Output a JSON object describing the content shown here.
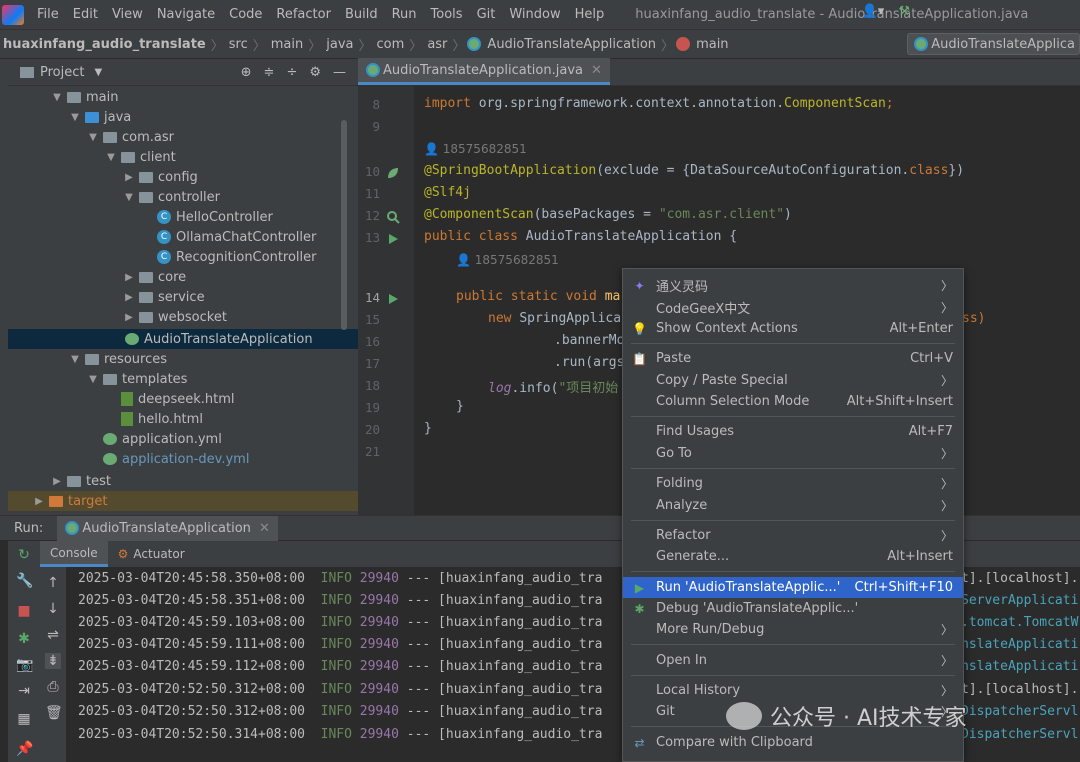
{
  "window": {
    "title": "huaxinfang_audio_translate - AudioTranslateApplication.java"
  },
  "menu": [
    "File",
    "Edit",
    "View",
    "Navigate",
    "Code",
    "Refactor",
    "Build",
    "Run",
    "Tools",
    "Git",
    "Window",
    "Help"
  ],
  "breadcrumb": {
    "project": "huaxinfang_audio_translate",
    "items": [
      "src",
      "main",
      "java",
      "com",
      "asr"
    ],
    "class": "AudioTranslateApplication",
    "method": "main"
  },
  "run_config": "AudioTranslateApplica",
  "project_panel": {
    "title": "Project",
    "tree": [
      {
        "label": "main"
      },
      {
        "label": "java"
      },
      {
        "label": "com.asr"
      },
      {
        "label": "client"
      },
      {
        "label": "config"
      },
      {
        "label": "controller"
      },
      {
        "label": "HelloController"
      },
      {
        "label": "OllamaChatController"
      },
      {
        "label": "RecognitionController"
      },
      {
        "label": "core"
      },
      {
        "label": "service"
      },
      {
        "label": "websocket"
      },
      {
        "label": "AudioTranslateApplication"
      },
      {
        "label": "resources"
      },
      {
        "label": "templates"
      },
      {
        "label": "deepseek.html"
      },
      {
        "label": "hello.html"
      },
      {
        "label": "application.yml"
      },
      {
        "label": "application-dev.yml"
      },
      {
        "label": "test"
      },
      {
        "label": "target"
      }
    ]
  },
  "editor": {
    "tab": "AudioTranslateApplication.java",
    "lines": [
      "8",
      "9",
      "10",
      "11",
      "12",
      "13",
      "14",
      "15",
      "16",
      "17",
      "18",
      "19",
      "20",
      "21"
    ],
    "author": "18575682851",
    "code": {
      "l8a": "import ",
      "l8b": "org.springframework.context.annotation.",
      "l8c": "ComponentScan",
      ";": ";",
      "l10a": "@SpringBootApplication",
      "l10b": "(exclude = {DataSourceAutoConfiguration.",
      "l10c": "class",
      "l10d": "})",
      "l11": "@Slf4j",
      "l12a": "@ComponentScan",
      "l12b": "(basePackages = ",
      "l12c": "\"com.asr.client\"",
      "l12d": ")",
      "l13a": "public class ",
      "l13b": "AudioTranslateApplication {",
      "l14a": "public static void ",
      "l14b": "ma",
      "l15a": "new ",
      "l15b": "SpringApplica",
      "l15c": "ss)",
      "l16": ".bannerMo",
      "l17": ".run(args",
      "l18a": "log",
      ".info(": ".info(",
      "l18c": "\"项目初始",
      "l19": "}",
      "l20": "}"
    }
  },
  "run": {
    "label": "Run:",
    "tab": "AudioTranslateApplication",
    "subtabs": [
      "Console",
      "Actuator"
    ],
    "logs": [
      {
        "ts": "2025-03-04T20:45:58.350+08:00",
        "lvl": "INFO",
        "pid": "29940",
        "rest": " --- [huaxinfang_audio_tra",
        "tail": "t].[localhost]."
      },
      {
        "ts": "2025-03-04T20:45:58.351+08:00",
        "lvl": "INFO",
        "pid": "29940",
        "rest": " --- [huaxinfang_audio_tra",
        "tail": "ServerApplicati"
      },
      {
        "ts": "2025-03-04T20:45:59.103+08:00",
        "lvl": "INFO",
        "pid": "29940",
        "rest": " --- [huaxinfang_audio_tra",
        "tail": ".tomcat.TomcatW"
      },
      {
        "ts": "2025-03-04T20:45:59.111+08:00",
        "lvl": "INFO",
        "pid": "29940",
        "rest": " --- [huaxinfang_audio_tra",
        "tail": "nslateApplicati"
      },
      {
        "ts": "2025-03-04T20:45:59.112+08:00",
        "lvl": "INFO",
        "pid": "29940",
        "rest": " --- [huaxinfang_audio_tra",
        "tail": "nslateApplicati"
      },
      {
        "ts": "2025-03-04T20:52:50.312+08:00",
        "lvl": "INFO",
        "pid": "29940",
        "rest": " --- [huaxinfang_audio_tra",
        "tail": "t].[localhost]."
      },
      {
        "ts": "2025-03-04T20:52:50.312+08:00",
        "lvl": "INFO",
        "pid": "29940",
        "rest": " --- [huaxinfang_audio_tra",
        "tail": "DispatcherServl"
      },
      {
        "ts": "2025-03-04T20:52:50.314+08:00",
        "lvl": "INFO",
        "pid": "29940",
        "rest": " --- [huaxinfang_audio_tra",
        "tail": "DispatcherServl"
      }
    ]
  },
  "context_menu": [
    {
      "label": "通义灵码",
      "sc": "",
      "sub": true
    },
    {
      "label": "CodeGeeX中文",
      "sc": "",
      "sub": true
    },
    {
      "label": "Show Context Actions",
      "sc": "Alt+Enter",
      "sub": false
    },
    {
      "label": "Paste",
      "sc": "Ctrl+V",
      "sub": false
    },
    {
      "label": "Copy / Paste Special",
      "sc": "",
      "sub": true
    },
    {
      "label": "Column Selection Mode",
      "sc": "Alt+Shift+Insert",
      "sub": false
    },
    {
      "label": "Find Usages",
      "sc": "Alt+F7",
      "sub": false
    },
    {
      "label": "Go To",
      "sc": "",
      "sub": true
    },
    {
      "label": "Folding",
      "sc": "",
      "sub": true
    },
    {
      "label": "Analyze",
      "sc": "",
      "sub": true
    },
    {
      "label": "Refactor",
      "sc": "",
      "sub": true
    },
    {
      "label": "Generate...",
      "sc": "Alt+Insert",
      "sub": false
    },
    {
      "label": "Run 'AudioTranslateApplic...'",
      "sc": "Ctrl+Shift+F10",
      "sub": false
    },
    {
      "label": "Debug 'AudioTranslateApplic...'",
      "sc": "",
      "sub": false
    },
    {
      "label": "More Run/Debug",
      "sc": "",
      "sub": true
    },
    {
      "label": "Open In",
      "sc": "",
      "sub": true
    },
    {
      "label": "Local History",
      "sc": "",
      "sub": true
    },
    {
      "label": "Git",
      "sc": "",
      "sub": true
    },
    {
      "label": "Compare with Clipboard",
      "sc": "",
      "sub": false
    }
  ],
  "watermark": "公众号 · AI技术专家"
}
